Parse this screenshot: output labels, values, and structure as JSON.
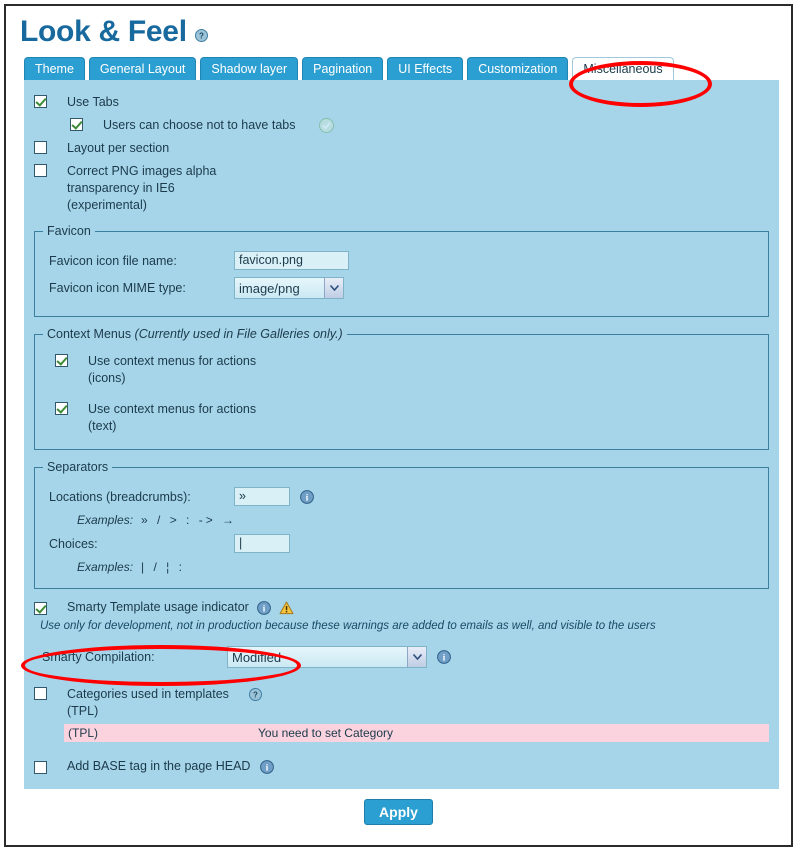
{
  "header": {
    "title": "Look & Feel",
    "help_icon": "help-icon"
  },
  "tabs": [
    {
      "label": "Theme",
      "active": false
    },
    {
      "label": "General Layout",
      "active": false
    },
    {
      "label": "Shadow layer",
      "active": false
    },
    {
      "label": "Pagination",
      "active": false
    },
    {
      "label": "UI Effects",
      "active": false
    },
    {
      "label": "Customization",
      "active": false
    },
    {
      "label": "Miscellaneous",
      "active": true
    }
  ],
  "options": {
    "use_tabs": {
      "label": "Use Tabs",
      "checked": true
    },
    "users_choose_no_tabs": {
      "label": "Users can choose not to have tabs",
      "checked": true,
      "status_icon": "green-check-circle-icon"
    },
    "layout_per_section": {
      "label": "Layout per section",
      "checked": false
    },
    "correct_png": {
      "label": "Correct PNG images alpha transparency in IE6 (experimental)",
      "checked": false
    }
  },
  "favicon": {
    "legend": "Favicon",
    "file_name_label": "Favicon icon file name:",
    "file_name_value": "favicon.png",
    "mime_label": "Favicon icon MIME type:",
    "mime_value": "image/png"
  },
  "context_menus": {
    "legend_main": "Context Menus ",
    "legend_italic": "(Currently used in File Galleries only.)",
    "icons_option": {
      "label": "Use context menus for actions (icons)",
      "checked": true
    },
    "text_option": {
      "label": "Use context menus for actions (text)",
      "checked": true
    }
  },
  "separators": {
    "legend": "Separators",
    "locations_label": "Locations (breadcrumbs):",
    "locations_value": "»",
    "locations_info_icon": "info-icon",
    "locations_examples_label": "Examples:",
    "locations_examples": "»  /  >  :  ->  →",
    "choices_label": "Choices:",
    "choices_value": "|",
    "choices_examples_label": "Examples:",
    "choices_examples": "|  /  ¦  :"
  },
  "smarty": {
    "indicator_label": "Smarty Template usage indicator",
    "indicator_checked": true,
    "indicator_info_icon": "info-icon",
    "indicator_warning_icon": "warning-triangle-icon",
    "note": "Use only for development, not in production because these warnings are added to emails as well, and visible to the users",
    "compilation_label": "Smarty Compilation:",
    "compilation_value": "Modified",
    "compilation_info_icon": "info-icon"
  },
  "categories": {
    "label": "Categories used in templates (TPL)",
    "checked": false,
    "help_icon": "help-icon",
    "alert_left": "(TPL)",
    "alert_text": "You need to set Category"
  },
  "base_tag": {
    "label": "Add BASE tag in the page HEAD",
    "checked": false,
    "info_icon": "info-icon"
  },
  "footer": {
    "apply_label": "Apply"
  },
  "colors": {
    "panel_bg": "#a6d5ea",
    "tab_bg": "#2b9fd1",
    "title": "#17699e",
    "alert_bg": "#fbd3de",
    "highlight": "#ff0000"
  }
}
